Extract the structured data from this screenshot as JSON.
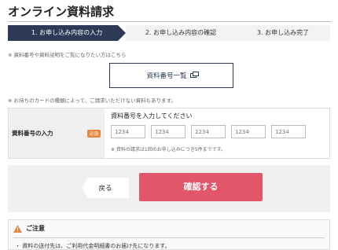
{
  "page": {
    "title": "オンライン資料請求"
  },
  "steps": [
    {
      "label": "1. お申し込み内容の入力",
      "active": true
    },
    {
      "label": "2. お申し込み内容の確認",
      "active": false
    },
    {
      "label": "3. お申し込み完了",
      "active": false
    }
  ],
  "notes": {
    "doc_number": "※ 資料番号や資料説明をご覧になりたい方はこちら",
    "card_type": "※ お持ちのカードの種類によって、ご請求いただけない資料もあります。"
  },
  "doc_list_button": {
    "label": "資料番号一覧",
    "icon": "new-window-icon"
  },
  "form": {
    "label": "資料番号の入力",
    "required_badge": "必須",
    "prompt": "資料番号を入力してください",
    "inputs": [
      {
        "placeholder": "1234"
      },
      {
        "placeholder": "1234"
      },
      {
        "placeholder": "1234"
      },
      {
        "placeholder": "1234"
      },
      {
        "placeholder": "1234"
      }
    ],
    "footnote": "※ 資料の請求は1回のお申し込みにつき5件までです。"
  },
  "actions": {
    "back_label": "戻る",
    "confirm_label": "確認する"
  },
  "caution": {
    "title": "ご注意",
    "icon": "warning-icon",
    "text": "・ 資料の送付先は、ご利用代金明細書のお届け先になります。"
  },
  "colors": {
    "step_active": "#2d3a57",
    "confirm_button": "#e2566a",
    "required_badge": "#e8873f",
    "warning": "#e8873f"
  }
}
